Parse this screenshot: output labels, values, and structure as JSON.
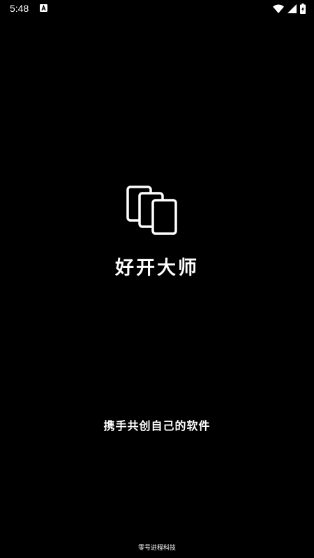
{
  "status_bar": {
    "time": "5:48",
    "icons": [
      "notification-a-icon",
      "wifi-icon",
      "cell-signal-icon",
      "battery-charging-icon"
    ]
  },
  "splash": {
    "logo_icon": "stacked-cards-icon",
    "app_name": "好开大师",
    "slogan": "携手共创自己的软件",
    "company": "零号进程科技"
  },
  "colors": {
    "background": "#000000",
    "foreground": "#ffffff"
  }
}
